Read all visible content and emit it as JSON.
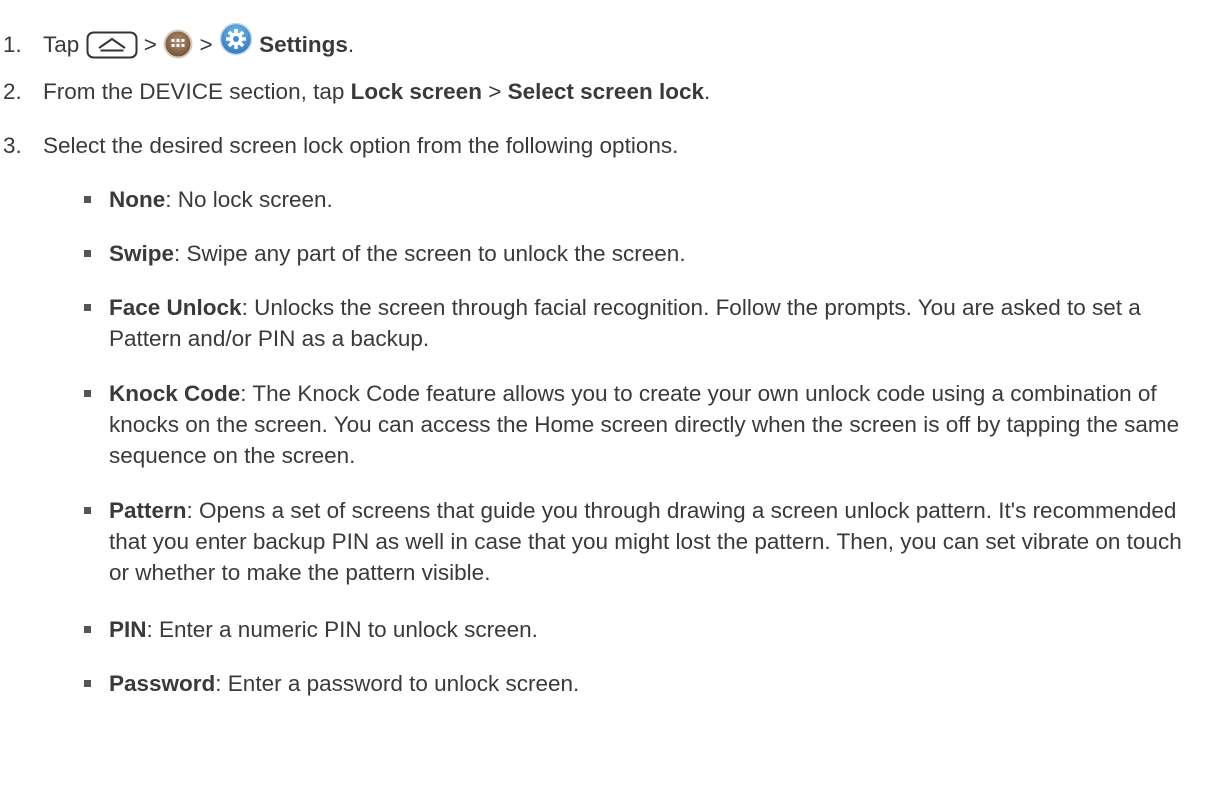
{
  "steps": [
    {
      "num": "1.",
      "pre": "Tap ",
      "sep1": " > ",
      "sep2": " > ",
      "bold": "Settings",
      "post": ".",
      "icons": [
        "home-key-icon",
        "apps-icon",
        "settings-gear-icon"
      ]
    },
    {
      "num": "2.",
      "pre": "From the DEVICE section, tap ",
      "bold1": "Lock screen",
      "mid": " > ",
      "bold2": "Select screen lock",
      "post": "."
    },
    {
      "num": "3.",
      "text": "Select the desired screen lock option from the following options."
    }
  ],
  "options": [
    {
      "name": "None",
      "desc": ": No lock screen."
    },
    {
      "name": "Swipe",
      "desc": ": Swipe any part of the screen to unlock the screen."
    },
    {
      "name": "Face Unlock",
      "desc": ": Unlocks the screen through facial recognition. Follow the prompts. You are asked to set a Pattern and/or PIN as a backup."
    },
    {
      "name": "Knock Code",
      "desc": ": The Knock Code feature allows you to create your own unlock code using a combination of knocks on the screen. You can access the Home screen directly when the screen is off by tapping the same sequence on the screen."
    },
    {
      "name": "Pattern",
      "desc": ": Opens a set of screens that guide you through drawing a screen unlock pattern. It's recommended that you enter backup PIN as well in case that you might lost the pattern. Then, you can set vibrate on touch or whether to make the pattern visible."
    },
    {
      "name": "PIN",
      "desc": ": Enter a numeric PIN to unlock screen."
    },
    {
      "name": "Password",
      "desc": ": Enter a password to unlock screen."
    }
  ],
  "colors": {
    "text": "#3a3a3a",
    "settings_icon": "#3d8fd6",
    "apps_icon": "#8a6a4d"
  }
}
